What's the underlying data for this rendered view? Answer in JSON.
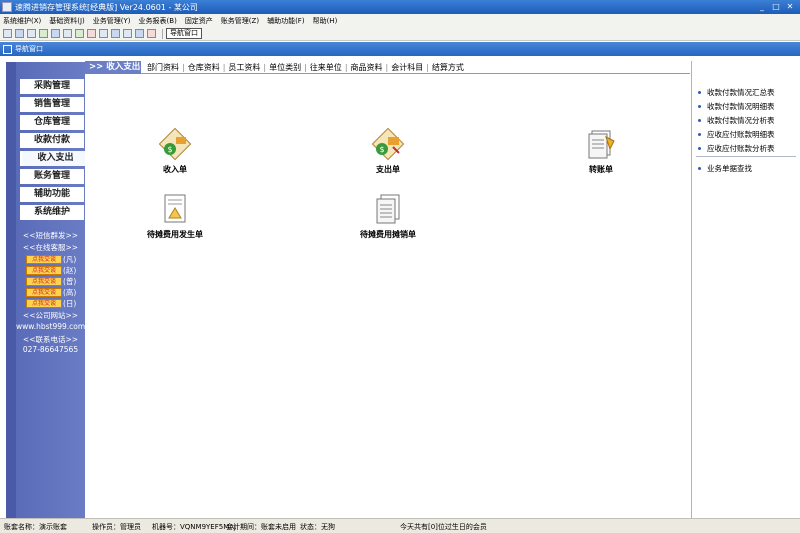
{
  "window": {
    "title": "速腾进销存管理系统[经典版] Ver24.0601 - 某公司"
  },
  "menu": [
    "系统维护(X)",
    "基础资料(J)",
    "业务管理(Y)",
    "业务报表(B)",
    "固定资产",
    "账务管理(Z)",
    "辅助功能(F)",
    "帮助(H)"
  ],
  "toolbar": {
    "nav_button": "导航窗口"
  },
  "nav_window": {
    "title": "导航窗口"
  },
  "sidebar": {
    "items": [
      "采购管理",
      "销售管理",
      "仓库管理",
      "收款付款",
      "收入支出",
      "账务管理",
      "辅助功能",
      "系统维护"
    ],
    "active_index": 4,
    "sms_link": "<<短信群发>>",
    "online_service": "<<在线客服>>",
    "qq": [
      {
        "badge": "点我交谈",
        "name": "(凡)"
      },
      {
        "badge": "点我交谈",
        "name": "(赵)"
      },
      {
        "badge": "点我交谈",
        "name": "(曾)"
      },
      {
        "badge": "点我交谈",
        "name": "(高)"
      },
      {
        "badge": "点我交谈",
        "name": "(日)"
      }
    ],
    "website_label": "<<公司网站>>",
    "website": "www.hbst999.com",
    "phone_label": "<<联系电话>>",
    "phone": "027-86647565"
  },
  "tabs": {
    "active": ">> 收入支出",
    "links": [
      "部门资料",
      "仓库资料",
      "员工资料",
      "单位类别",
      "往来单位",
      "商品资料",
      "会计科目",
      "结算方式"
    ]
  },
  "main": {
    "items": [
      {
        "label": "收入单",
        "icon": "income-voucher-icon"
      },
      {
        "label": "支出单",
        "icon": "expense-voucher-icon"
      },
      {
        "label": "转账单",
        "icon": "transfer-voucher-icon"
      },
      {
        "label": "待摊费用发生单",
        "icon": "deferred-expense-occur-icon"
      },
      {
        "label": "待摊费用摊销单",
        "icon": "deferred-expense-amortize-icon"
      }
    ]
  },
  "right_panel": {
    "links": [
      "收款付款情况汇总表",
      "收款付款情况明细表",
      "收款付款情况分析表",
      "应收应付账款明细表",
      "应收应付账款分析表"
    ],
    "extra": "业务单据查找"
  },
  "status": {
    "account": "账套名称：演示账套",
    "operator": "操作员：管理员",
    "machine": "机器号：VQNM9YEF5MAJ",
    "period": "会计期间：账套未启用",
    "state": "状态：无狗",
    "birthday": "今天共有[0]位过生日的会员"
  },
  "colors": {
    "title": "#2566c2",
    "sidebar": "#6a7cc4",
    "tab_active": "#6b7fc6"
  }
}
